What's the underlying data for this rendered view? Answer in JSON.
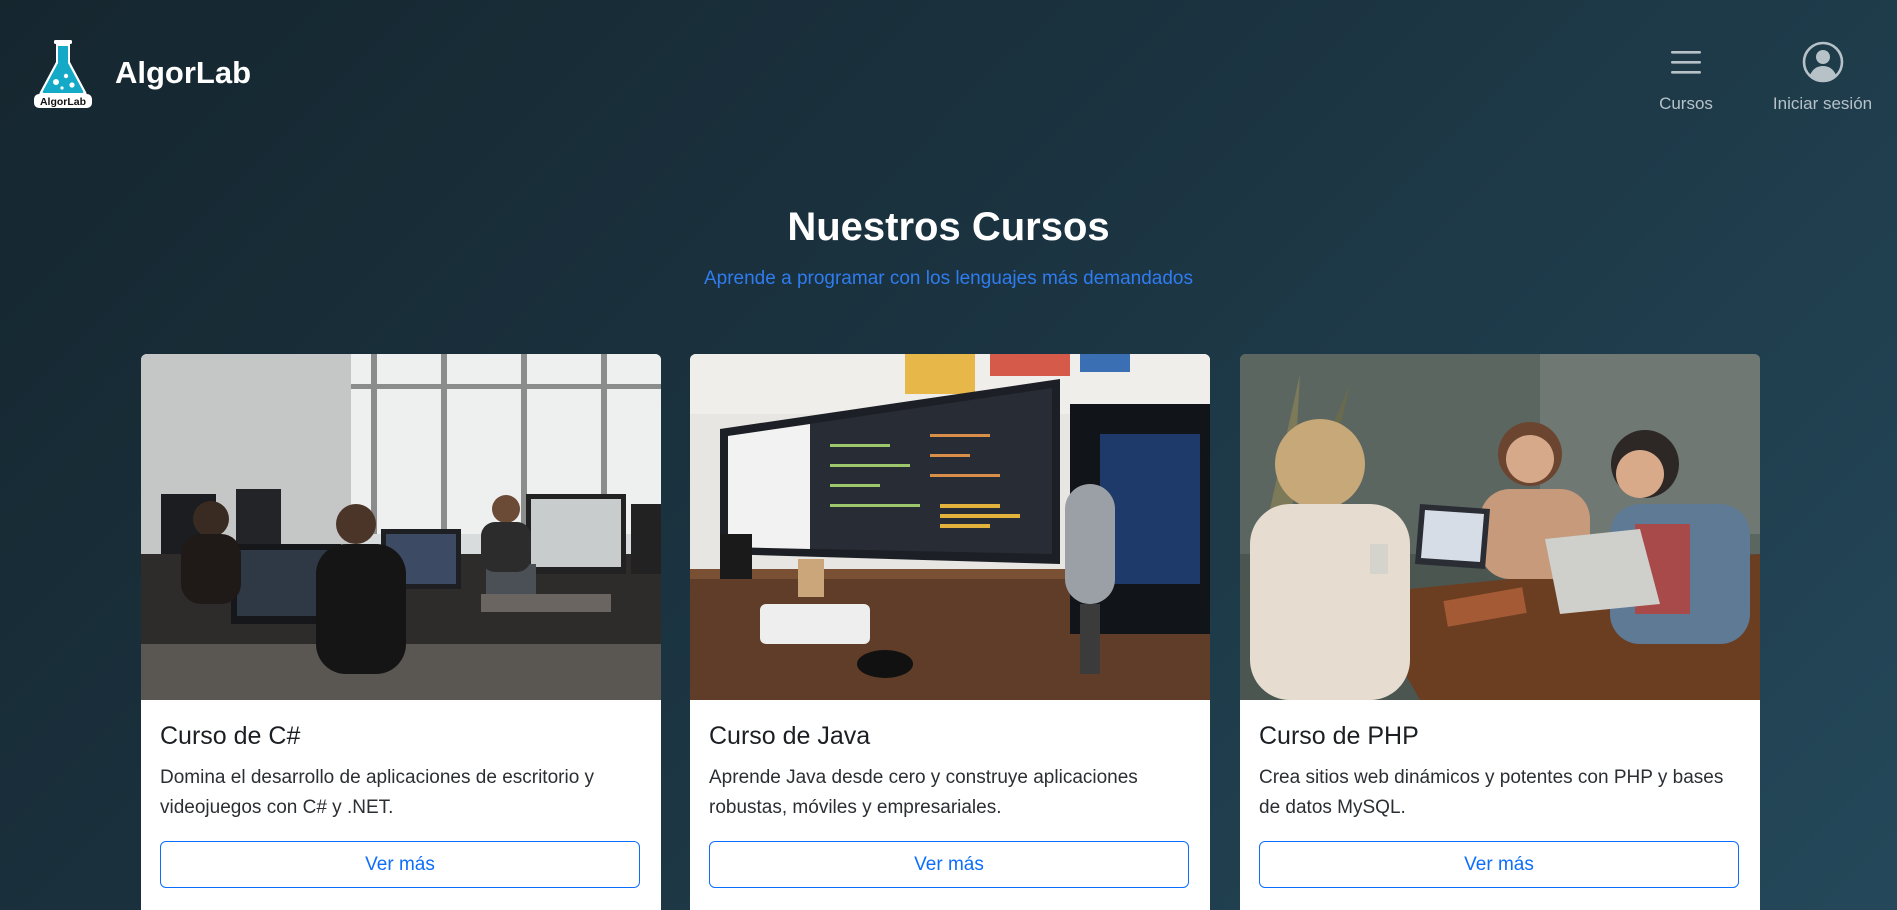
{
  "brand": {
    "name": "AlgorLab",
    "logo_text": "AlgorLab"
  },
  "nav": {
    "courses_label": "Cursos",
    "login_label": "Iniciar sesión"
  },
  "section": {
    "title": "Nuestros Cursos",
    "subtitle": "Aprende a programar con los lenguajes más demandados"
  },
  "courses": [
    {
      "title": "Curso de C#",
      "description": "Domina el desarrollo de aplicaciones de escritorio y videojuegos con C# y .NET.",
      "button_label": "Ver más",
      "image": "office-developers-photo"
    },
    {
      "title": "Curso de Java",
      "description": "Aprende Java desde cero y construye aplicaciones robustas, móviles y empresariales.",
      "button_label": "Ver más",
      "image": "code-monitor-desk-photo"
    },
    {
      "title": "Curso de PHP",
      "description": "Crea sitios web dinámicos y potentes con PHP y bases de datos MySQL.",
      "button_label": "Ver más",
      "image": "team-laptops-cafe-photo"
    }
  ],
  "colors": {
    "accent": "#0d6efd",
    "subtitle": "#2f7cf0",
    "nav_text": "#b6c2c8",
    "logo_teal": "#14a9c7"
  }
}
